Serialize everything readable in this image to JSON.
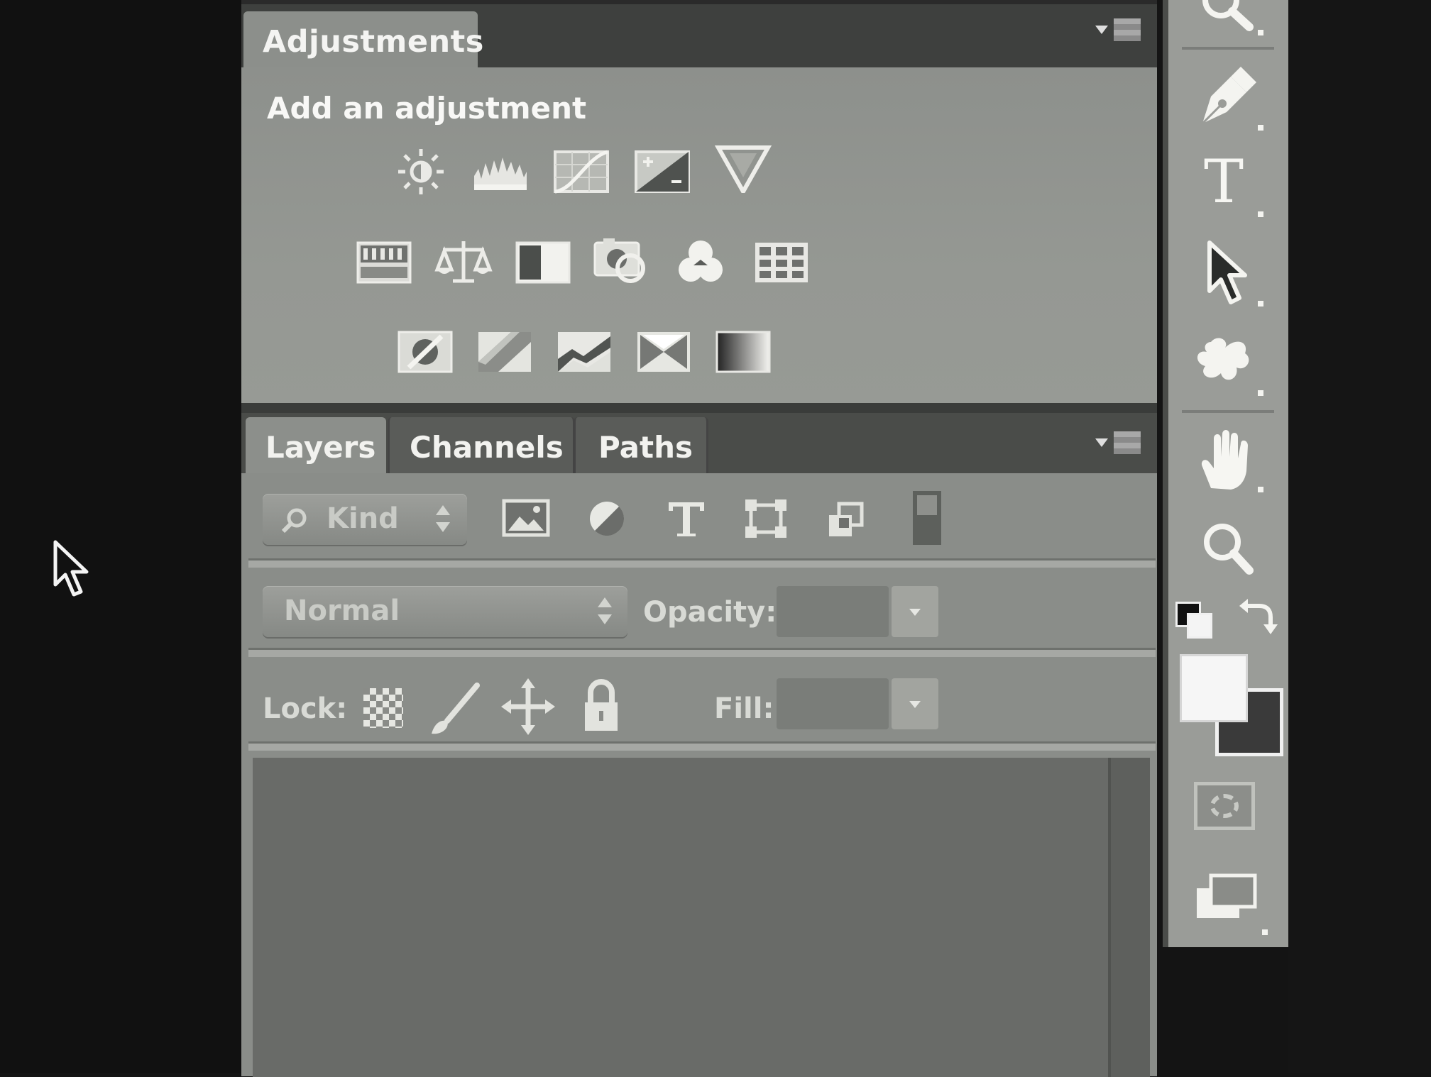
{
  "adjustments_panel": {
    "tab_label": "Adjustments",
    "subtitle": "Add an adjustment",
    "icons_row1": [
      "brightness-contrast-icon",
      "levels-icon",
      "curves-icon",
      "exposure-icon",
      "vibrance-icon"
    ],
    "icons_row2": [
      "hue-saturation-icon",
      "color-balance-icon",
      "black-white-icon",
      "photo-filter-icon",
      "channel-mixer-icon",
      "color-lookup-icon"
    ],
    "icons_row3": [
      "invert-icon",
      "posterize-icon",
      "threshold-icon",
      "selective-color-icon",
      "gradient-map-icon"
    ]
  },
  "layers_panel": {
    "tabs": [
      "Layers",
      "Channels",
      "Paths"
    ],
    "filter": {
      "label": "Kind",
      "icons": [
        "pixel-layer-filter-icon",
        "adjustment-layer-filter-icon",
        "type-layer-filter-icon",
        "shape-layer-filter-icon",
        "smart-object-filter-icon",
        "filter-toggle-icon"
      ]
    },
    "blend_mode": "Normal",
    "opacity_label": "Opacity:",
    "opacity_value": "",
    "lock_label": "Lock:",
    "lock_icons": [
      "lock-transparent-pixels-icon",
      "lock-image-pixels-icon",
      "lock-position-icon",
      "lock-all-icon"
    ],
    "fill_label": "Fill:",
    "fill_value": ""
  },
  "tools_panel": {
    "tools": [
      "magnifier-tool-icon",
      "pen-tool-icon",
      "type-tool-icon",
      "path-selection-tool-icon",
      "custom-shape-tool-icon",
      "hand-tool-icon",
      "zoom-tool-icon"
    ],
    "type_tool_glyph": "T",
    "foreground_color": "#f6f6f6",
    "background_color": "#3a3a3a"
  },
  "colors": {
    "panel_light": "#8d908c",
    "panel_dark": "#3e403e",
    "text_light": "#f4f4f2"
  }
}
